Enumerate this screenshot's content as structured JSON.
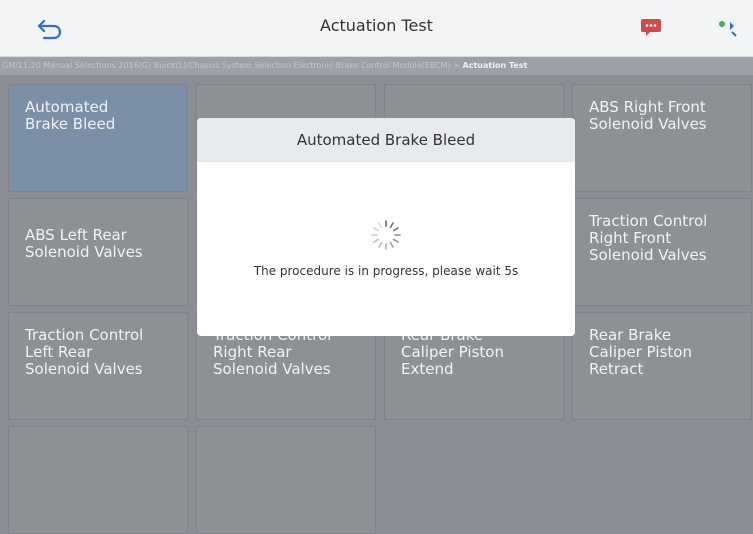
{
  "header": {
    "title": "Actuation Test"
  },
  "breadcrumb": {
    "path": "GM/11.20 Manual Selections 2016(G) Buick(L)/Chassis System Selection Electronic Brake Control Module(EBCM)",
    "separator": ">",
    "current": "Actuation Test"
  },
  "tiles": [
    {
      "lines": [
        "Automated",
        "Brake Bleed"
      ],
      "selected": true
    },
    {
      "lines": [
        ""
      ],
      "selected": false
    },
    {
      "lines": [
        ""
      ],
      "selected": false
    },
    {
      "lines": [
        "ABS Right Front",
        "Solenoid Valves"
      ],
      "selected": false
    },
    {
      "lines": [
        "ABS Left Rear",
        "Solenoid Valves"
      ],
      "selected": false
    },
    {
      "lines": [
        ""
      ],
      "selected": false
    },
    {
      "lines": [
        ""
      ],
      "selected": false
    },
    {
      "lines": [
        "Traction Control",
        "Right Front",
        "Solenoid Valves"
      ],
      "selected": false
    },
    {
      "lines": [
        "Traction Control",
        "Left Rear",
        "Solenoid Valves"
      ],
      "selected": false
    },
    {
      "lines": [
        "Traction Control",
        "Right Rear",
        "Solenoid Valves"
      ],
      "selected": false
    },
    {
      "lines": [
        "Rear Brake",
        "Caliper Piston",
        "Extend"
      ],
      "selected": false
    },
    {
      "lines": [
        "Rear Brake",
        "Caliper Piston",
        "Retract"
      ],
      "selected": false
    }
  ],
  "dialog": {
    "title": "Automated Brake Bleed",
    "message": "The procedure is in progress, please wait 5s"
  },
  "icons": {
    "back": "back-arrow-icon",
    "messages": "message-icon",
    "wifi": "wifi-icon",
    "spinner": "loading-spinner-icon"
  },
  "colors": {
    "accent_selected": "#7b8fa6",
    "tile": "#8d9196"
  }
}
